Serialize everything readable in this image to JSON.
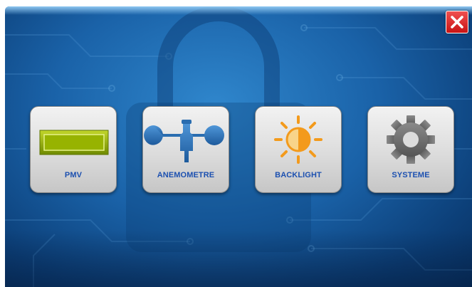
{
  "window": {
    "close_icon": "close-icon"
  },
  "menu": {
    "items": [
      {
        "label": "PMV",
        "icon": "lcd-display-icon"
      },
      {
        "label": "ANEMOMETRE",
        "icon": "anemometer-icon"
      },
      {
        "label": "BACKLIGHT",
        "icon": "sun-brightness-icon"
      },
      {
        "label": "SYSTEME",
        "icon": "gear-icon"
      }
    ]
  },
  "colors": {
    "background": "#1a62a8",
    "label": "#1c50b0",
    "close_button": "#d91c1c",
    "lcd_green": "#8aa800",
    "anemometer_blue": "#2a6db0",
    "sun_orange": "#f39a1c",
    "gear_gray": "#707070"
  }
}
